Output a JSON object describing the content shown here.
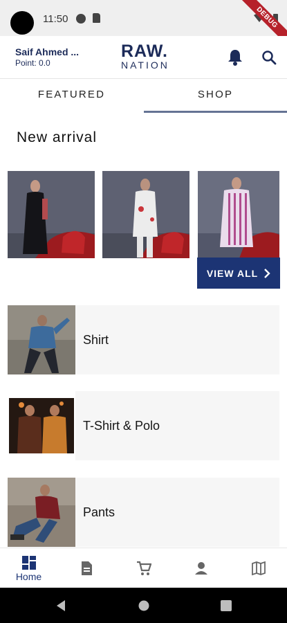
{
  "status_bar": {
    "time": "11:50",
    "debug_label": "DEBUG"
  },
  "app_bar": {
    "user_name": "Saif Ahmed ...",
    "points": "Point: 0.0",
    "logo_top": "RAW.",
    "logo_bottom": "NATION"
  },
  "tabs": [
    {
      "label": "FEATURED"
    },
    {
      "label": "SHOP"
    }
  ],
  "new_arrival": {
    "title": "New arrival",
    "view_all_label": "VIEW ALL"
  },
  "categories": [
    {
      "label": "Shirt"
    },
    {
      "label": "T-Shirt & Polo"
    },
    {
      "label": "Pants"
    }
  ],
  "bottom_nav": {
    "home_label": "Home",
    "items": [
      "home-icon",
      "document-icon",
      "cart-icon",
      "person-icon",
      "map-icon"
    ]
  },
  "colors": {
    "brand": "#1c2b59",
    "accent": "#1c3474",
    "tab_indicator": "#657394"
  }
}
